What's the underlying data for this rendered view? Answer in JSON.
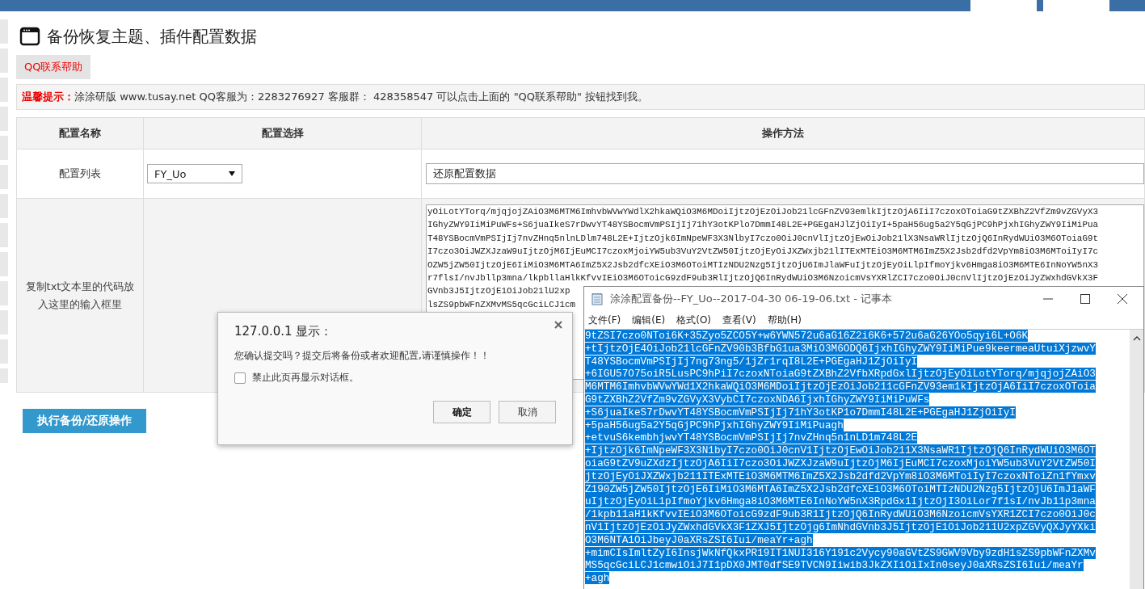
{
  "page": {
    "title": "备份恢复主题、插件配置数据",
    "help_button": "QQ联系帮助",
    "notice": {
      "label": "温馨提示：",
      "text": "涂涂研版 www.tusay.net QQ客服为：2283276927 客服群： 428358547 可以点击上面的 \"QQ联系帮助\" 按钮找到我。"
    }
  },
  "table": {
    "columns": [
      "配置名称",
      "配置选择",
      "操作方法"
    ],
    "rows": [
      {
        "kind": "select",
        "label": "配置列表",
        "select_value": "FY_Uo",
        "action_value": "还原配置数据"
      },
      {
        "kind": "code",
        "label": "复制txt文本里的代码放入这里的输入框里",
        "code_lines": [
          "yOiLotYTorq/mjqjojZAiO3M6MTM6ImhvbWVwYWdlX2hkaWQiO3M6MDoiIjtzOjEzOiJob21lcGFnZV93emlkIjtzOjA6IiI7czoxOToiaG9tZXBhZ2VfZm9vZGVyX3",
          "IGhyZWY9IiMiPuWFs+S6juaIkeS7rDwvYT48YSBocmVmPSIjIj71hY3otKPlo7DmmI48L2E+PGEgaHJlZjOiIyI+5paH56ug5a2Y5qGjPC9hPjxhIGhyZWY9IiMiPua",
          "T48YSBocmVmPSIjIj7nvZHnq5nlnLDlm748L2E+IjtzOjk6ImNpeWF3X3NlbyI7czo0OiJ0cnVlIjtzOjEwOiJob21lX3NsaWRlIjtzOjQ6InRydWUiO3M6OToiaG9t",
          "I7czo3OiJWZXJzaW9uIjtzOjM6IjEuMCI7czoxMjoiYW5ub3VuY2VtZW50IjtzOjEyOiJXZWxjb21lITExMTEiO3M6MTM6ImZ5X2Jsb2dfd2VpYm8iO3M6MToiIyI7c",
          "OZW5jZW50IjtzOjE6IiMiO3M6MTA6ImZ5X2Jsb2dfcXEiO3M6OToiMTIzNDU2Nzg5IjtzOjU6ImJlaWFuIjtzOjEyOiLlpIfmoYjkv6Hmga8iO3M6MTE6InNoYW5nX3",
          "r7flsI/nvJbllp3mna/lkpbllaHlkKfvvIEiO3M6OToicG9zdF9ub3RlIjtzOjQ6InRydWUiO3M6NzoicmVsYXRlZCI7czo0OiJ0cnVlIjtzOjEzOiJyZWxhdGVkX3F",
          "GVnb3J5IjtzOjE1OiJob21lU2xp",
          "lsZS9pbWFnZXMvMS5qcGciLCJ1cm"
        ]
      }
    ]
  },
  "submit_button": "执行备份/还原操作",
  "dialog": {
    "title": "127.0.0.1 显示：",
    "message": "您确认提交吗？提交后将备份或者欢迎配置,请谨慎操作！！",
    "checkbox": {
      "label": "禁止此页再显示对话框。",
      "checked": false
    },
    "buttons": [
      "确定",
      "取消"
    ]
  },
  "notepad": {
    "title": "涂涂配置备份--FY_Uo--2017-04-30 06-19-06.txt - 记事本",
    "menu": [
      "文件(F)",
      "编辑(E)",
      "格式(O)",
      "查看(V)",
      "帮助(H)"
    ],
    "text_selected": true,
    "lines": [
      "9tZSI7czo0NToi6K+35Zyo5ZCO5Y+w6YWN572u6aG16Z2i6K6+572u6aG26YOo5qyi6L+O6K",
      "+tIjtzOjE4OiJob21lcGFnZV90b3BfbG1ua3MiO3M6ODQ6IjxhIGhyZWY9IiMiPue9keermeaUtuiXjzwvY",
      "T48YSBocmVmPSIjIj7ng73ng5/1jZr1rqI8L2E+PGEgaHJ1ZjOiIyI",
      "+6IGU57O75oiR5LusPC9hPiI7czoxNToiaG9tZXBhZ2VfbXRpdGxlIjtzOjEyOiLotYTorq/mjqjojZAiO3",
      "M6MTM6ImhvbWVwYWd1X2hkaWQiO3M6MDoiIjtzOjEzOiJob211cGFnZV93em1kIjtzOjA6IiI7czoxOToia",
      "G9tZXBhZ2VfZm9vZGVyX3VybCI7czoxNDA6IjxhIGhyZWY9IiMiPuWFs",
      "+S6juaIkeS7rDwvYT48YSBocmVmPSIjIj71hY3otKP1o7DmmI48L2E+PGEgaHJ1ZjOiIyI",
      "+5paH56ug5a2Y5qGjPC9hPjxhIGhyZWY9IiMiPuagh",
      "+etvuS6kembhjwvYT48YSBocmVmPSIjIj7nvZHnq5n1nLD1m748L2E",
      "+IjtzOjk6ImNpeWF3X3N1byI7czo0OiJ0cnV1IjtzOjEwOiJob211X3NsaWR1IjtzOjQ6InRydWUiO3M6OT",
      "oiaG9tZV9uZXdzIjtzOjA6IiI7czo3OiJWZXJzaW9uIjtzOjM6IjEuMCI7czoxMjoiYW5ub3VuY2VtZW50I",
      "jtzOjEyOiJXZWxjb211ITExMTEiO3M6MTM6ImZ5X2Jsb2dfd2VpYm8iO3M6MToiIyI7czoxNToiZn1fYmxv",
      "Z190ZW5jZW50IjtzOjE6IiMiO3M6MTA6ImZ5X2Jsb2dfcXEiO3M6OToiMTIzNDU2Nzg5IjtzOjU6ImJ1aWF",
      "uIjtzOjEyOiL1pIfmoYjkv6Hmga8iO3M6MTE6InNoYW5nX3RpdGx1IjtzOjI3OiLor7f1sI/nvJb11p3mna",
      "/1kpb11aH1kKfvvIEiO3M6OToicG9zdF9ub3R1IjtzOjQ6InRydWUiO3M6NzoicmVsYXR1ZCI7czo0OiJ0c",
      "nV1IjtzOjEzOiJyZWxhdGVkX3F1ZXJ5IjtzOjg6ImNhdGVnb3J5IjtzOjE1OiJob211U2xpZGVyQXJyYXki",
      "O3M6NTA1OiJbeyJ0aXRsZSI6Iui/meaYr+agh",
      "+mimCIsImltZyI6InsjWkNfQkxPR19IT1NUI316Y191c2Vycy90aGVtZS9GWV9Vby9zdH1sZS9pbWFnZXMv",
      "MS5qcGciLCJ1cmwiOiJ7I1pDX0JMT0dfSE9TVCN9Iiwib3JkZXIiOiIxIn0seyJ0aXRsZSI6Iui/meaYr",
      "+agh"
    ]
  }
}
